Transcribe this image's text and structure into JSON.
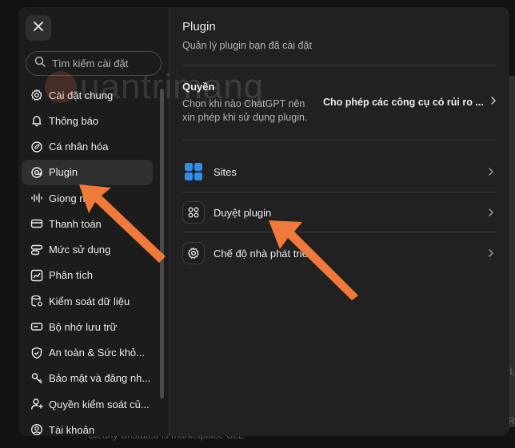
{
  "backdrop": {
    "bottom_text": "Clearly Unstated is marketplace ULE",
    "right_text_1": "L",
    "right_text_2": "R"
  },
  "search": {
    "placeholder": "Tìm kiếm cài đặt"
  },
  "sidebar": {
    "items": [
      {
        "label": "Cài đặt chung",
        "icon": "gear-icon"
      },
      {
        "label": "Thông báo",
        "icon": "bell-icon"
      },
      {
        "label": "Cá nhân hóa",
        "icon": "personalize-icon"
      },
      {
        "label": "Plugin",
        "icon": "plugin-icon",
        "active": true
      },
      {
        "label": "Giọng nói",
        "icon": "voice-icon"
      },
      {
        "label": "Thanh toán",
        "icon": "card-icon"
      },
      {
        "label": "Mức sử dụng",
        "icon": "usage-icon"
      },
      {
        "label": "Phân tích",
        "icon": "chart-icon"
      },
      {
        "label": "Kiểm soát dữ liệu",
        "icon": "database-icon"
      },
      {
        "label": "Bộ nhớ lưu trữ",
        "icon": "storage-icon"
      },
      {
        "label": "An toàn & Sức khỏ...",
        "icon": "shield-icon"
      },
      {
        "label": "Bảo mật và đăng nh...",
        "icon": "lock-icon"
      },
      {
        "label": "Quyền kiểm soát củ...",
        "icon": "user-icon"
      },
      {
        "label": "Tài khoản",
        "icon": "account-icon"
      }
    ]
  },
  "main": {
    "title": "Plugin",
    "subtitle": "Quản lý plugin bạn đã cài đặt",
    "permissions": {
      "title": "Quyền",
      "description": "Chọn khi nào ChatGPT nên xin phép khi sử dụng plugin.",
      "value": "Cho phép các công cụ có rủi ro ..."
    },
    "rows": [
      {
        "label": "Sites",
        "icon": "sites-icon"
      },
      {
        "label": "Duyệt plugin",
        "icon": "grid-icon"
      },
      {
        "label": "Chế độ nhà phát triển",
        "icon": "gear-icon"
      }
    ]
  },
  "watermark": "uantrimang",
  "colors": {
    "arrow": "#f07a3a",
    "sites_blue": "#2f8fea",
    "modal_bg": "#212121",
    "sidebar_bg": "#1c1c1c"
  }
}
